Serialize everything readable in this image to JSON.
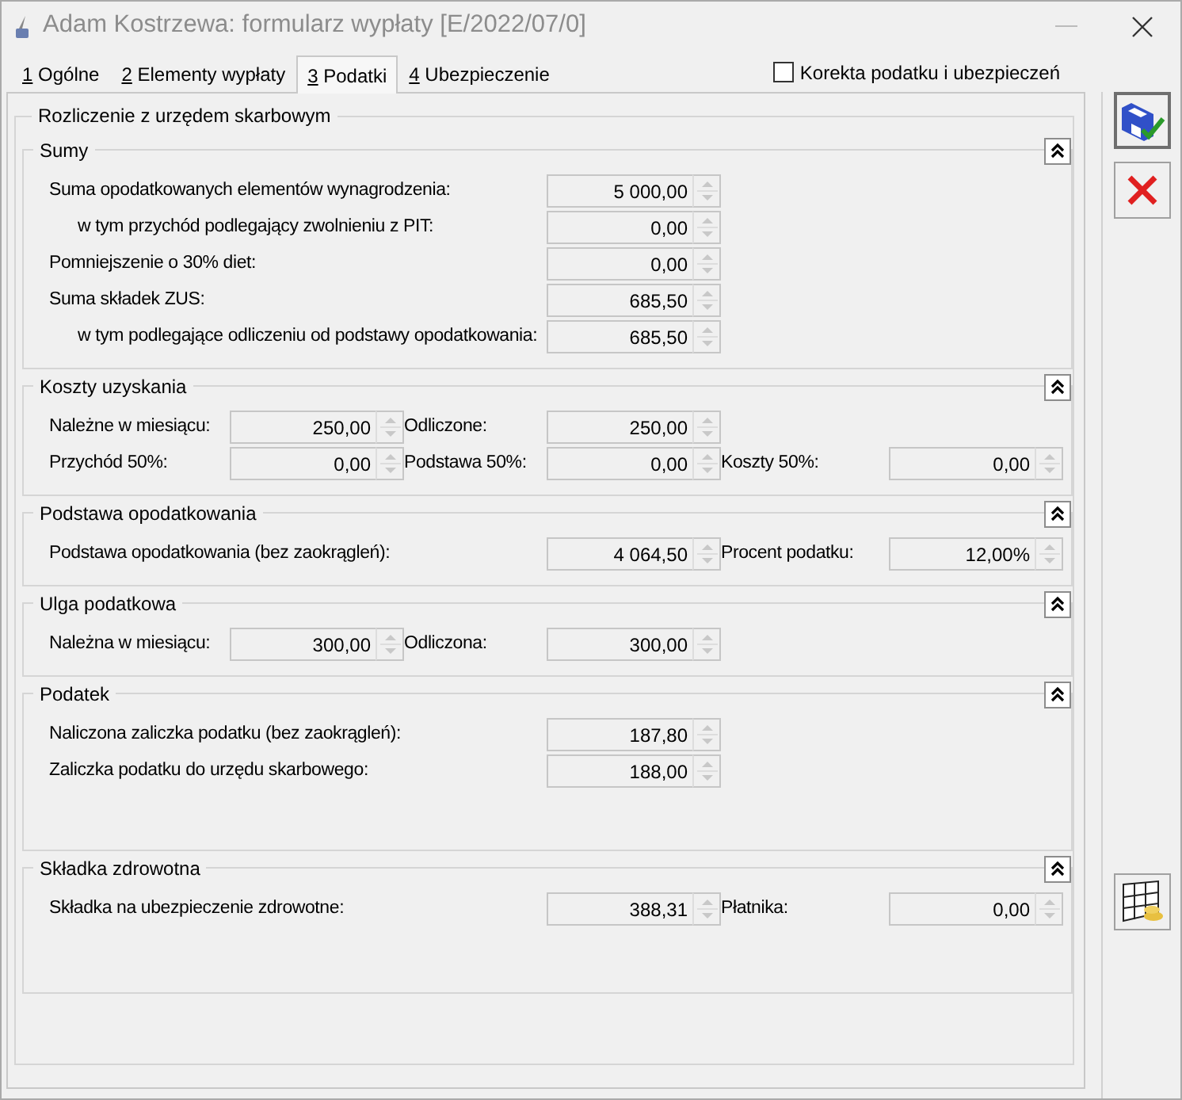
{
  "window": {
    "title": "Adam Kostrzewa: formularz wypłaty [E/2022/07/0]"
  },
  "tabs": [
    {
      "key": "1",
      "label": "Ogólne",
      "selected": false
    },
    {
      "key": "2",
      "label": "Elementy wypłaty",
      "selected": false
    },
    {
      "key": "3",
      "label": "Podatki",
      "selected": true
    },
    {
      "key": "4",
      "label": "Ubezpieczenie",
      "selected": false
    }
  ],
  "correction_checkbox": {
    "label": "Korekta podatku i ubezpieczeń",
    "checked": false
  },
  "group": {
    "title": "Rozliczenie z urzędem skarbowym",
    "sections": [
      {
        "title": "Sumy",
        "expanded": true,
        "rows": [
          [
            {
              "kind": "wide",
              "indent": false,
              "label": "Suma opodatkowanych elementów wynagrodzenia:",
              "value": "5 000,00"
            }
          ],
          [
            {
              "kind": "wide",
              "indent": true,
              "label": "w tym przychód podlegający zwolnieniu z PIT:",
              "value": "0,00"
            }
          ],
          [
            {
              "kind": "wide",
              "indent": false,
              "label": "Pomniejszenie o 30% diet:",
              "value": "0,00"
            }
          ],
          [
            {
              "kind": "wide",
              "indent": false,
              "label": "Suma składek ZUS:",
              "value": "685,50"
            }
          ],
          [
            {
              "kind": "wide",
              "indent": true,
              "label": "w tym podlegające odliczeniu od podstawy opodatkowania:",
              "value": "685,50"
            }
          ]
        ]
      },
      {
        "title": "Koszty uzyskania",
        "expanded": true,
        "rows": [
          [
            {
              "kind": "narrow",
              "indent": false,
              "label": "Należne w miesiącu:",
              "value": "250,00"
            },
            {
              "kind": "narrow",
              "indent": false,
              "label": "Odliczone:",
              "value": "250,00"
            }
          ],
          [
            {
              "kind": "narrow",
              "indent": false,
              "label": "Przychód 50%:",
              "value": "0,00"
            },
            {
              "kind": "narrow",
              "indent": false,
              "label": "Podstawa 50%:",
              "value": "0,00"
            },
            {
              "kind": "narrow",
              "indent": false,
              "label": "Koszty 50%:",
              "value": "0,00"
            }
          ]
        ]
      },
      {
        "title": "Podstawa opodatkowania",
        "expanded": true,
        "rows": [
          [
            {
              "kind": "wide",
              "indent": false,
              "label": "Podstawa opodatkowania (bez zaokrągleń):",
              "value": "4 064,50"
            },
            {
              "kind": "narrow",
              "indent": false,
              "label": "Procent podatku:",
              "value": "12,00%"
            }
          ]
        ]
      },
      {
        "title": "Ulga podatkowa",
        "expanded": true,
        "rows": [
          [
            {
              "kind": "narrow",
              "indent": false,
              "label": "Należna w miesiącu:",
              "value": "300,00"
            },
            {
              "kind": "narrow",
              "indent": false,
              "label": "Odliczona:",
              "value": "300,00"
            }
          ]
        ]
      },
      {
        "title": "Podatek",
        "expanded": true,
        "rows": [
          [
            {
              "kind": "wide",
              "indent": false,
              "label": "Naliczona zaliczka podatku (bez zaokrągleń):",
              "value": "187,80"
            }
          ],
          [
            {
              "kind": "wide",
              "indent": false,
              "label": "Zaliczka podatku do urzędu skarbowego:",
              "value": "188,00"
            }
          ]
        ]
      },
      {
        "title": "Składka zdrowotna",
        "expanded": true,
        "rows": [
          [
            {
              "kind": "wide",
              "indent": false,
              "label": "Składka na ubezpieczenie zdrowotne:",
              "value": "388,31"
            },
            {
              "kind": "narrow",
              "indent": false,
              "label": "Płatnika:",
              "value": "0,00"
            }
          ]
        ]
      }
    ]
  },
  "toolbar": [
    {
      "kind": "save"
    },
    {
      "kind": "cancel"
    },
    {
      "kind": "payments"
    }
  ]
}
